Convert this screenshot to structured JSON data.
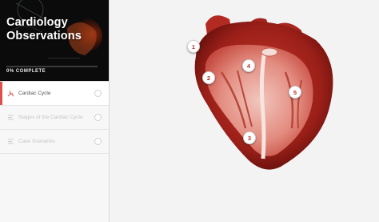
{
  "course": {
    "title_line1": "Cardiology",
    "title_line2": "Observations",
    "progress_label": "0% COMPLETE",
    "progress_fraction": 0
  },
  "lessons": [
    {
      "label": "Cardiac Cycle",
      "icon": "tools-icon",
      "active": true
    },
    {
      "label": "Stages of the Cardiac Cycle",
      "icon": "list-icon",
      "active": false
    },
    {
      "label": "Case Scenarios",
      "icon": "list-icon",
      "active": false
    }
  ],
  "markers": [
    "1",
    "2",
    "3",
    "4",
    "5"
  ],
  "colors": {
    "accent": "#e0504a",
    "marker_text": "#b8322c"
  }
}
